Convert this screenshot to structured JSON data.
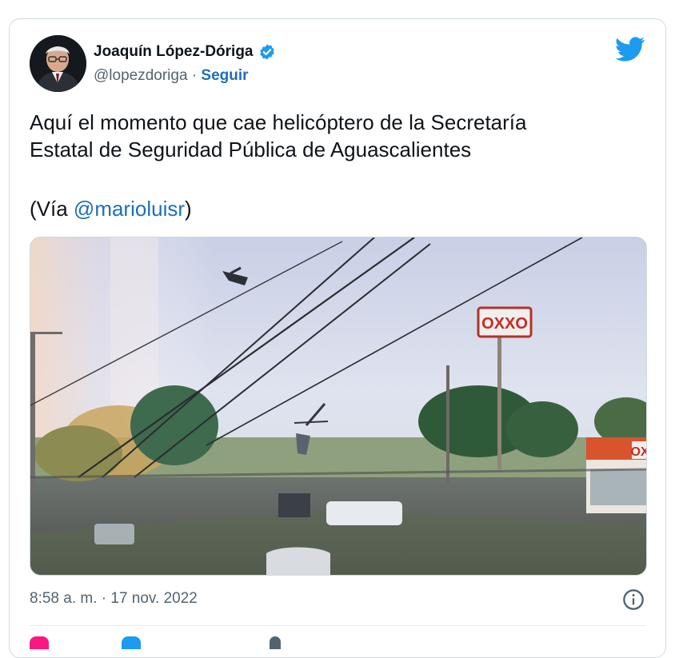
{
  "author": {
    "name": "Joaquín López-Dóriga",
    "handle": "@lopezdoriga",
    "separator": " · ",
    "follow_label": "Seguir"
  },
  "tweet": {
    "text": "Aquí el momento que cae helicóptero de la Secretaría\nEstatal de Seguridad Pública de Aguascalientes",
    "via_prefix": "(Vía ",
    "via_mention": "@marioluisr",
    "via_suffix": ")"
  },
  "media": {
    "sign_text": "OXXO",
    "store_sign_text": "OX"
  },
  "footer": {
    "timestamp": "8:58 a. m. · 17 nov. 2022"
  },
  "colors": {
    "twitter_blue": "#1d9bf0",
    "link_blue": "#1d6fb8",
    "oxxo_red": "#d52b1e"
  },
  "icons": [
    "verified-badge-icon",
    "twitter-bird-icon",
    "info-icon",
    "like-icon",
    "reply-icon",
    "share-icon"
  ]
}
